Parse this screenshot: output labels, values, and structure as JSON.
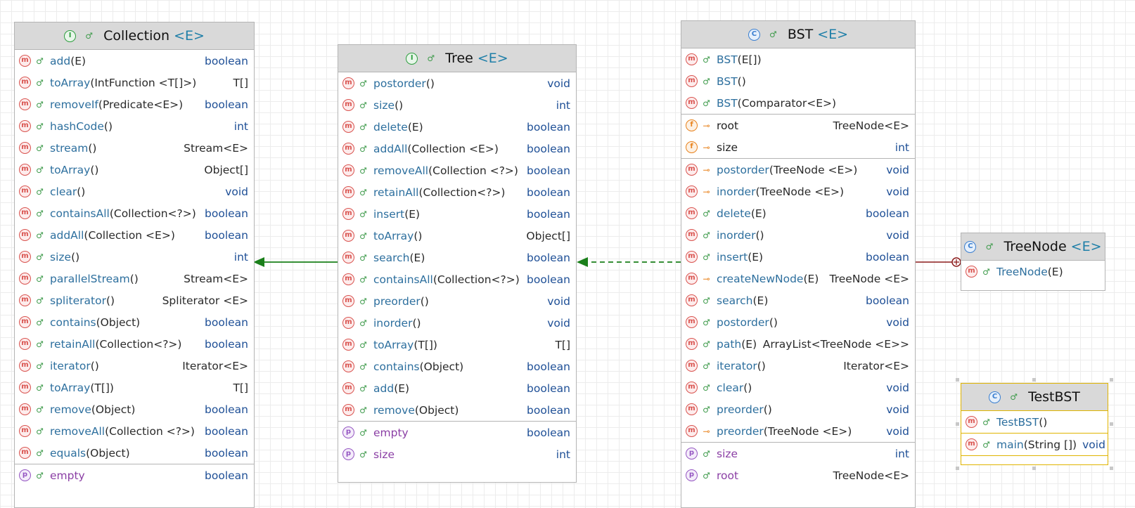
{
  "colors": {
    "header_bg": "#d9d9d9",
    "method_icon": "#d9534f",
    "field_icon": "#e8821c",
    "property_icon": "#9556c2",
    "interface_icon": "#2e9e3f",
    "class_icon": "#3b7fd0",
    "inherit_arrow": "#1a7f1a",
    "nested_link": "#8b1a1a",
    "selected_border": "#e0b400"
  },
  "collection": {
    "title": "Collection",
    "generic": "<E>",
    "kind_icon": "interface-icon",
    "members": [
      {
        "kind": "m",
        "name": "add",
        "sig": "(E)",
        "ret": "boolean"
      },
      {
        "kind": "m",
        "name": "toArray",
        "sig": "(IntFunction <T[]>)",
        "ret": "T[]"
      },
      {
        "kind": "m",
        "name": "removeIf",
        "sig": "(Predicate<E>)",
        "ret": "boolean"
      },
      {
        "kind": "m",
        "name": "hashCode",
        "sig": "()",
        "ret": "int"
      },
      {
        "kind": "m",
        "name": "stream",
        "sig": "()",
        "ret": "Stream<E>"
      },
      {
        "kind": "m",
        "name": "toArray",
        "sig": "()",
        "ret": "Object[]"
      },
      {
        "kind": "m",
        "name": "clear",
        "sig": "()",
        "ret": "void"
      },
      {
        "kind": "m",
        "name": "containsAll",
        "sig": "(Collection<?>)",
        "ret": "boolean"
      },
      {
        "kind": "m",
        "name": "addAll",
        "sig": "(Collection <E>)",
        "ret": "boolean"
      },
      {
        "kind": "m",
        "name": "size",
        "sig": "()",
        "ret": "int"
      },
      {
        "kind": "m",
        "name": "parallelStream",
        "sig": "()",
        "ret": "Stream<E>"
      },
      {
        "kind": "m",
        "name": "spliterator",
        "sig": "()",
        "ret": "Spliterator <E>"
      },
      {
        "kind": "m",
        "name": "contains",
        "sig": "(Object)",
        "ret": "boolean"
      },
      {
        "kind": "m",
        "name": "retainAll",
        "sig": "(Collection<?>)",
        "ret": "boolean"
      },
      {
        "kind": "m",
        "name": "iterator",
        "sig": "()",
        "ret": "Iterator<E>"
      },
      {
        "kind": "m",
        "name": "toArray",
        "sig": "(T[])",
        "ret": "T[]"
      },
      {
        "kind": "m",
        "name": "remove",
        "sig": "(Object)",
        "ret": "boolean"
      },
      {
        "kind": "m",
        "name": "removeAll",
        "sig": "(Collection <?>)",
        "ret": "boolean"
      },
      {
        "kind": "m",
        "name": "equals",
        "sig": "(Object)",
        "ret": "boolean"
      }
    ],
    "properties": [
      {
        "kind": "p",
        "name": "empty",
        "sig": "",
        "ret": "boolean"
      }
    ]
  },
  "tree": {
    "title": "Tree",
    "generic": "<E>",
    "kind_icon": "interface-icon",
    "members": [
      {
        "kind": "m",
        "name": "postorder",
        "sig": "()",
        "ret": "void"
      },
      {
        "kind": "m",
        "name": "size",
        "sig": "()",
        "ret": "int"
      },
      {
        "kind": "m",
        "name": "delete",
        "sig": "(E)",
        "ret": "boolean"
      },
      {
        "kind": "m",
        "name": "addAll",
        "sig": "(Collection <E>)",
        "ret": "boolean"
      },
      {
        "kind": "m",
        "name": "removeAll",
        "sig": "(Collection <?>)",
        "ret": "boolean"
      },
      {
        "kind": "m",
        "name": "retainAll",
        "sig": "(Collection<?>)",
        "ret": "boolean"
      },
      {
        "kind": "m",
        "name": "insert",
        "sig": "(E)",
        "ret": "boolean"
      },
      {
        "kind": "m",
        "name": "toArray",
        "sig": "()",
        "ret": "Object[]"
      },
      {
        "kind": "m",
        "name": "search",
        "sig": "(E)",
        "ret": "boolean"
      },
      {
        "kind": "m",
        "name": "containsAll",
        "sig": "(Collection<?>)",
        "ret": "boolean"
      },
      {
        "kind": "m",
        "name": "preorder",
        "sig": "()",
        "ret": "void"
      },
      {
        "kind": "m",
        "name": "inorder",
        "sig": "()",
        "ret": "void"
      },
      {
        "kind": "m",
        "name": "toArray",
        "sig": "(T[])",
        "ret": "T[]"
      },
      {
        "kind": "m",
        "name": "contains",
        "sig": "(Object)",
        "ret": "boolean"
      },
      {
        "kind": "m",
        "name": "add",
        "sig": "(E)",
        "ret": "boolean"
      },
      {
        "kind": "m",
        "name": "remove",
        "sig": "(Object)",
        "ret": "boolean"
      }
    ],
    "properties": [
      {
        "kind": "p",
        "name": "empty",
        "sig": "",
        "ret": "boolean"
      },
      {
        "kind": "p",
        "name": "size",
        "sig": "",
        "ret": "int"
      }
    ]
  },
  "bst": {
    "title": "BST",
    "generic": "<E>",
    "kind_icon": "class-icon",
    "constructors": [
      {
        "kind": "m",
        "name": "BST",
        "sig": "(E[])",
        "ret": ""
      },
      {
        "kind": "m",
        "name": "BST",
        "sig": "()",
        "ret": ""
      },
      {
        "kind": "m",
        "name": "BST",
        "sig": "(Comparator<E>)",
        "ret": ""
      }
    ],
    "fields": [
      {
        "kind": "f",
        "vis": "private",
        "name": "root",
        "sig": "",
        "ret": "TreeNode<E>"
      },
      {
        "kind": "f",
        "vis": "private",
        "name": "size",
        "sig": "",
        "ret": "int"
      }
    ],
    "members": [
      {
        "kind": "m",
        "vis": "private",
        "name": "postorder",
        "sig": "(TreeNode <E>)",
        "ret": "void"
      },
      {
        "kind": "m",
        "vis": "private",
        "name": "inorder",
        "sig": "(TreeNode <E>)",
        "ret": "void"
      },
      {
        "kind": "m",
        "name": "delete",
        "sig": "(E)",
        "ret": "boolean"
      },
      {
        "kind": "m",
        "name": "inorder",
        "sig": "()",
        "ret": "void"
      },
      {
        "kind": "m",
        "name": "insert",
        "sig": "(E)",
        "ret": "boolean"
      },
      {
        "kind": "m",
        "vis": "private",
        "name": "createNewNode",
        "sig": "(E)",
        "ret": "TreeNode <E>"
      },
      {
        "kind": "m",
        "name": "search",
        "sig": "(E)",
        "ret": "boolean"
      },
      {
        "kind": "m",
        "name": "postorder",
        "sig": "()",
        "ret": "void"
      },
      {
        "kind": "m",
        "name": "path",
        "sig": "(E)",
        "ret": "ArrayList<TreeNode <E>>"
      },
      {
        "kind": "m",
        "name": "iterator",
        "sig": "()",
        "ret": "Iterator<E>"
      },
      {
        "kind": "m",
        "name": "clear",
        "sig": "()",
        "ret": "void"
      },
      {
        "kind": "m",
        "name": "preorder",
        "sig": "()",
        "ret": "void"
      },
      {
        "kind": "m",
        "vis": "private",
        "name": "preorder",
        "sig": "(TreeNode <E>)",
        "ret": "void"
      }
    ],
    "properties": [
      {
        "kind": "p",
        "name": "size",
        "sig": "",
        "ret": "int"
      },
      {
        "kind": "p",
        "name": "root",
        "sig": "",
        "ret": "TreeNode<E>"
      }
    ]
  },
  "treenode": {
    "title": "TreeNode",
    "generic": "<E>",
    "kind_icon": "nested-class-icon",
    "members": [
      {
        "kind": "m",
        "name": "TreeNode",
        "sig": "(E)",
        "ret": ""
      }
    ]
  },
  "testbst": {
    "title": "TestBST",
    "generic": "",
    "kind_icon": "runnable-class-icon",
    "constructors": [
      {
        "kind": "m",
        "name": "TestBST",
        "sig": "()",
        "ret": ""
      }
    ],
    "members": [
      {
        "kind": "m",
        "name": "main",
        "sig": "(String [])",
        "ret": "void"
      }
    ]
  }
}
